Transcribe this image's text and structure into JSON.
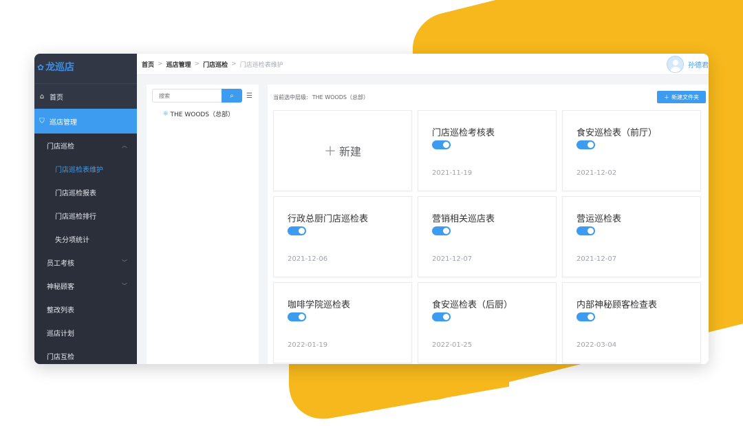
{
  "app": {
    "logo": "龙巡店",
    "user_name": "孙德君"
  },
  "breadcrumb": [
    "首页",
    "巡店管理",
    "门店巡检",
    "门店巡检表维护"
  ],
  "sidebar": {
    "items": [
      {
        "label": "首页",
        "icon": "store-icon"
      },
      {
        "label": "巡店管理",
        "icon": "shield-icon",
        "active": true
      },
      {
        "label": "门店巡检",
        "expanded": true
      },
      {
        "label": "门店巡检表维护",
        "current": true
      },
      {
        "label": "门店巡检报表"
      },
      {
        "label": "门店巡检排行"
      },
      {
        "label": "失分项统计"
      },
      {
        "label": "员工考核"
      },
      {
        "label": "神秘顾客"
      },
      {
        "label": "整改列表"
      },
      {
        "label": "巡店计划"
      },
      {
        "label": "门店互检"
      }
    ]
  },
  "tree": {
    "search_placeholder": "搜索",
    "root_node": "THE WOODS（总部）"
  },
  "main": {
    "current_level_label": "当前选中层级:",
    "current_level_value": "THE WOODS（总部）",
    "new_folder_label": "新建文件夹",
    "new_card_label": "新建",
    "cards": [
      {
        "title": "门店巡检考核表",
        "enabled": true,
        "date": "2021-11-19"
      },
      {
        "title": "食安巡检表（前厅）",
        "enabled": true,
        "date": "2021-12-02"
      },
      {
        "title": "行政总厨门店巡检表",
        "enabled": true,
        "date": "2021-12-06"
      },
      {
        "title": "营销相关巡店表",
        "enabled": true,
        "date": "2021-12-07"
      },
      {
        "title": "营运巡检表",
        "enabled": true,
        "date": "2021-12-07"
      },
      {
        "title": "咖啡学院巡检表",
        "enabled": true,
        "date": "2022-01-19"
      },
      {
        "title": "食安巡检表（后厨）",
        "enabled": true,
        "date": "2022-01-25"
      },
      {
        "title": "内部神秘顾客检查表",
        "enabled": true,
        "date": "2022-03-04"
      }
    ]
  },
  "colors": {
    "accent": "#3d9bf0",
    "sidebar_bg": "#313744",
    "backdrop": "#f6b81c"
  }
}
